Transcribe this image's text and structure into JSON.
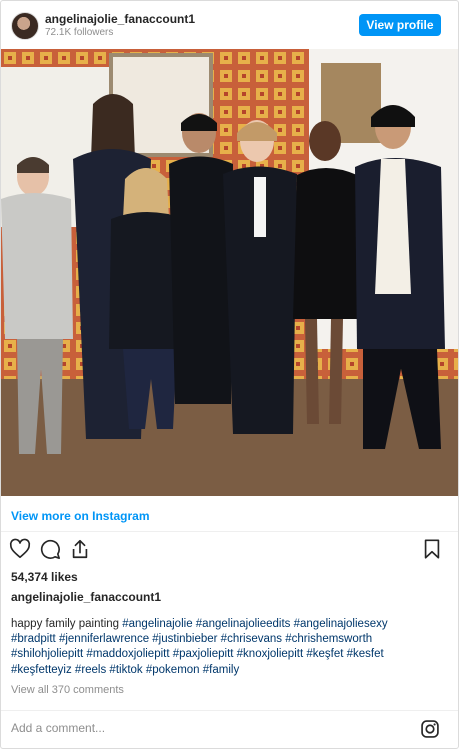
{
  "header": {
    "username": "angelinajolie_fanaccount1",
    "followers": "72.1K followers",
    "view_profile_label": "View profile",
    "accent_color": "#0095f6"
  },
  "post": {
    "view_more_label": "View more on Instagram",
    "likes": "54,374 likes",
    "caption_user": "angelinajolie_fanaccount1",
    "caption_text": "happy family painting",
    "hashtags": "#angelinajolie #angelinajolieedits #angelinajoliesexy #bradpitt #jenniferlawrence #justinbieber #chrisevans #chrishemsworth #shilohjoliepitt #maddoxjoliepitt #paxjoliepitt #knoxjoliepitt #keşfet #kesfet #keşfetteyiz #reels #tiktok #pokemon #family",
    "view_all_comments": "View all 370 comments",
    "comment_placeholder": "Add a comment...",
    "icons": [
      "heart-icon",
      "comment-icon",
      "share-icon",
      "bookmark-icon",
      "instagram-icon"
    ]
  }
}
